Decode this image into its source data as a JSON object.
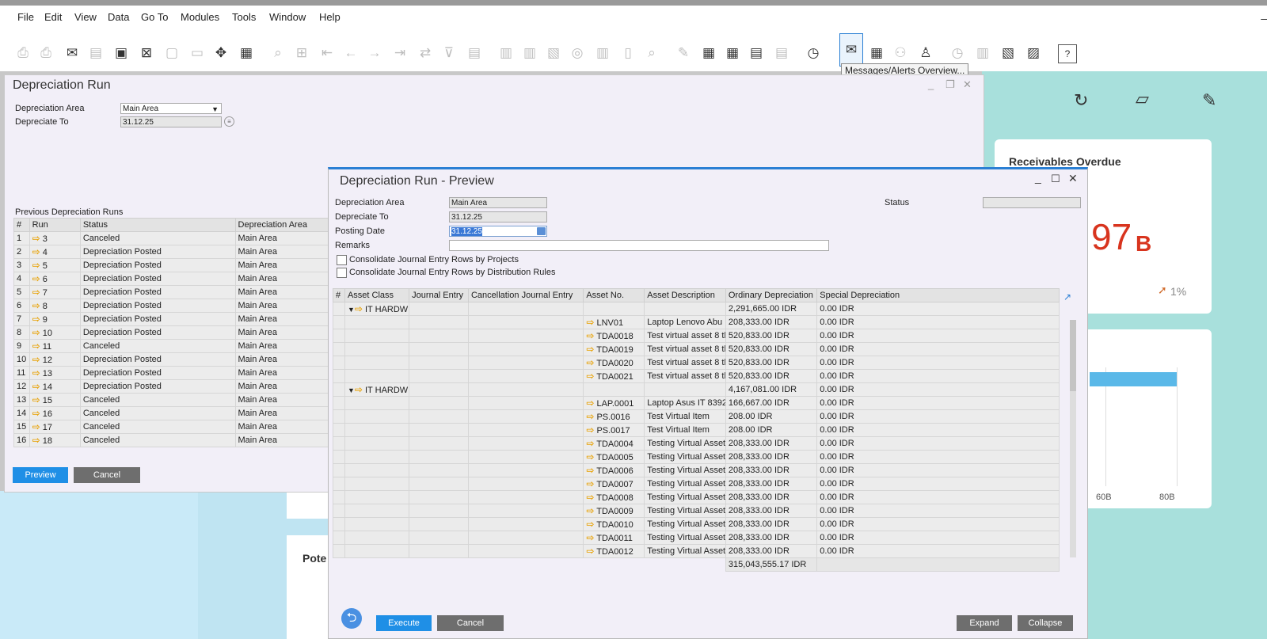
{
  "menu": [
    "File",
    "Edit",
    "View",
    "Data",
    "Go To",
    "Modules",
    "Tools",
    "Window",
    "Help"
  ],
  "menu_min": "–",
  "tooltip": "Messages/Alerts Overview...",
  "dashboard": {
    "receivables_title": "Receivables Overdue",
    "big_number": "97",
    "big_unit": "B",
    "trend": "1%",
    "axis_60": "60B",
    "axis_80": "80B",
    "pote": "Pote"
  },
  "win1": {
    "title": "Depreciation Run",
    "fields": {
      "area_label": "Depreciation Area",
      "area_value": "Main Area",
      "to_label": "Depreciate To",
      "to_value": "31.12.25"
    },
    "section_title": "Previous Depreciation Runs",
    "columns": [
      "#",
      "Run",
      "Status",
      "Depreciation Area"
    ],
    "rows": [
      [
        "1",
        "3",
        "Canceled",
        "Main Area"
      ],
      [
        "2",
        "4",
        "Depreciation Posted",
        "Main Area"
      ],
      [
        "3",
        "5",
        "Depreciation Posted",
        "Main Area"
      ],
      [
        "4",
        "6",
        "Depreciation Posted",
        "Main Area"
      ],
      [
        "5",
        "7",
        "Depreciation Posted",
        "Main Area"
      ],
      [
        "6",
        "8",
        "Depreciation Posted",
        "Main Area"
      ],
      [
        "7",
        "9",
        "Depreciation Posted",
        "Main Area"
      ],
      [
        "8",
        "10",
        "Depreciation Posted",
        "Main Area"
      ],
      [
        "9",
        "11",
        "Canceled",
        "Main Area"
      ],
      [
        "10",
        "12",
        "Depreciation Posted",
        "Main Area"
      ],
      [
        "11",
        "13",
        "Depreciation Posted",
        "Main Area"
      ],
      [
        "12",
        "14",
        "Depreciation Posted",
        "Main Area"
      ],
      [
        "13",
        "15",
        "Canceled",
        "Main Area"
      ],
      [
        "14",
        "16",
        "Canceled",
        "Main Area"
      ],
      [
        "15",
        "17",
        "Canceled",
        "Main Area"
      ],
      [
        "16",
        "18",
        "Canceled",
        "Main Area"
      ]
    ],
    "preview_btn": "Preview",
    "cancel_btn": "Cancel"
  },
  "win2": {
    "title": "Depreciation Run - Preview",
    "fields": {
      "area_label": "Depreciation Area",
      "area_value": "Main Area",
      "to_label": "Depreciate To",
      "to_value": "31.12.25",
      "posting_label": "Posting Date",
      "posting_value": "31.12.25",
      "remarks_label": "Remarks",
      "status_label": "Status"
    },
    "chk_projects": "Consolidate Journal Entry Rows by Projects",
    "chk_rules": "Consolidate Journal Entry Rows by Distribution Rules",
    "columns": [
      "#",
      "Asset Class",
      "Journal Entry",
      "Cancellation Journal Entry",
      "Asset No.",
      "Asset Description",
      "Ordinary Depreciation",
      "Special Depreciation"
    ],
    "rows": [
      {
        "group": true,
        "cls": "IT HARDW",
        "no": "",
        "desc": "",
        "ord": "2,291,665.00 IDR",
        "spec": "0.00 IDR"
      },
      {
        "group": false,
        "cls": "",
        "no": "LNV01",
        "desc": "Laptop Lenovo Abu",
        "ord": "208,333.00 IDR",
        "spec": "0.00 IDR"
      },
      {
        "group": false,
        "cls": "",
        "no": "TDA0018",
        "desc": "Test virtual asset 8 th",
        "ord": "520,833.00 IDR",
        "spec": "0.00 IDR"
      },
      {
        "group": false,
        "cls": "",
        "no": "TDA0019",
        "desc": "Test virtual asset 8 th",
        "ord": "520,833.00 IDR",
        "spec": "0.00 IDR"
      },
      {
        "group": false,
        "cls": "",
        "no": "TDA0020",
        "desc": "Test virtual asset 8 th",
        "ord": "520,833.00 IDR",
        "spec": "0.00 IDR"
      },
      {
        "group": false,
        "cls": "",
        "no": "TDA0021",
        "desc": "Test virtual asset 8 th",
        "ord": "520,833.00 IDR",
        "spec": "0.00 IDR"
      },
      {
        "group": true,
        "cls": "IT HARDW",
        "no": "",
        "desc": "",
        "ord": "4,167,081.00 IDR",
        "spec": "0.00 IDR"
      },
      {
        "group": false,
        "cls": "",
        "no": "LAP.0001",
        "desc": "Laptop Asus IT 8392",
        "ord": "166,667.00 IDR",
        "spec": "0.00 IDR"
      },
      {
        "group": false,
        "cls": "",
        "no": "PS.0016",
        "desc": "Test Virtual Item",
        "ord": "208.00 IDR",
        "spec": "0.00 IDR"
      },
      {
        "group": false,
        "cls": "",
        "no": "PS.0017",
        "desc": "Test Virtual Item",
        "ord": "208.00 IDR",
        "spec": "0.00 IDR"
      },
      {
        "group": false,
        "cls": "",
        "no": "TDA0004",
        "desc": "Testing Virtual Asset",
        "ord": "208,333.00 IDR",
        "spec": "0.00 IDR"
      },
      {
        "group": false,
        "cls": "",
        "no": "TDA0005",
        "desc": "Testing Virtual Asset",
        "ord": "208,333.00 IDR",
        "spec": "0.00 IDR"
      },
      {
        "group": false,
        "cls": "",
        "no": "TDA0006",
        "desc": "Testing Virtual Asset",
        "ord": "208,333.00 IDR",
        "spec": "0.00 IDR"
      },
      {
        "group": false,
        "cls": "",
        "no": "TDA0007",
        "desc": "Testing Virtual Asset",
        "ord": "208,333.00 IDR",
        "spec": "0.00 IDR"
      },
      {
        "group": false,
        "cls": "",
        "no": "TDA0008",
        "desc": "Testing Virtual Asset",
        "ord": "208,333.00 IDR",
        "spec": "0.00 IDR"
      },
      {
        "group": false,
        "cls": "",
        "no": "TDA0009",
        "desc": "Testing Virtual Asset",
        "ord": "208,333.00 IDR",
        "spec": "0.00 IDR"
      },
      {
        "group": false,
        "cls": "",
        "no": "TDA0010",
        "desc": "Testing Virtual Asset",
        "ord": "208,333.00 IDR",
        "spec": "0.00 IDR"
      },
      {
        "group": false,
        "cls": "",
        "no": "TDA0011",
        "desc": "Testing Virtual Asset",
        "ord": "208,333.00 IDR",
        "spec": "0.00 IDR"
      },
      {
        "group": false,
        "cls": "",
        "no": "TDA0012",
        "desc": "Testing Virtual Asset",
        "ord": "208,333.00 IDR",
        "spec": "0.00 IDR"
      }
    ],
    "total": "315,043,555.17 IDR",
    "execute_btn": "Execute",
    "cancel_btn": "Cancel",
    "expand_btn": "Expand",
    "collapse_btn": "Collapse"
  },
  "colors": {
    "accent": "#1f8fe6",
    "dashboard": "#a8e0dc",
    "red": "#d8341e",
    "bar": "#5ab8e8"
  }
}
